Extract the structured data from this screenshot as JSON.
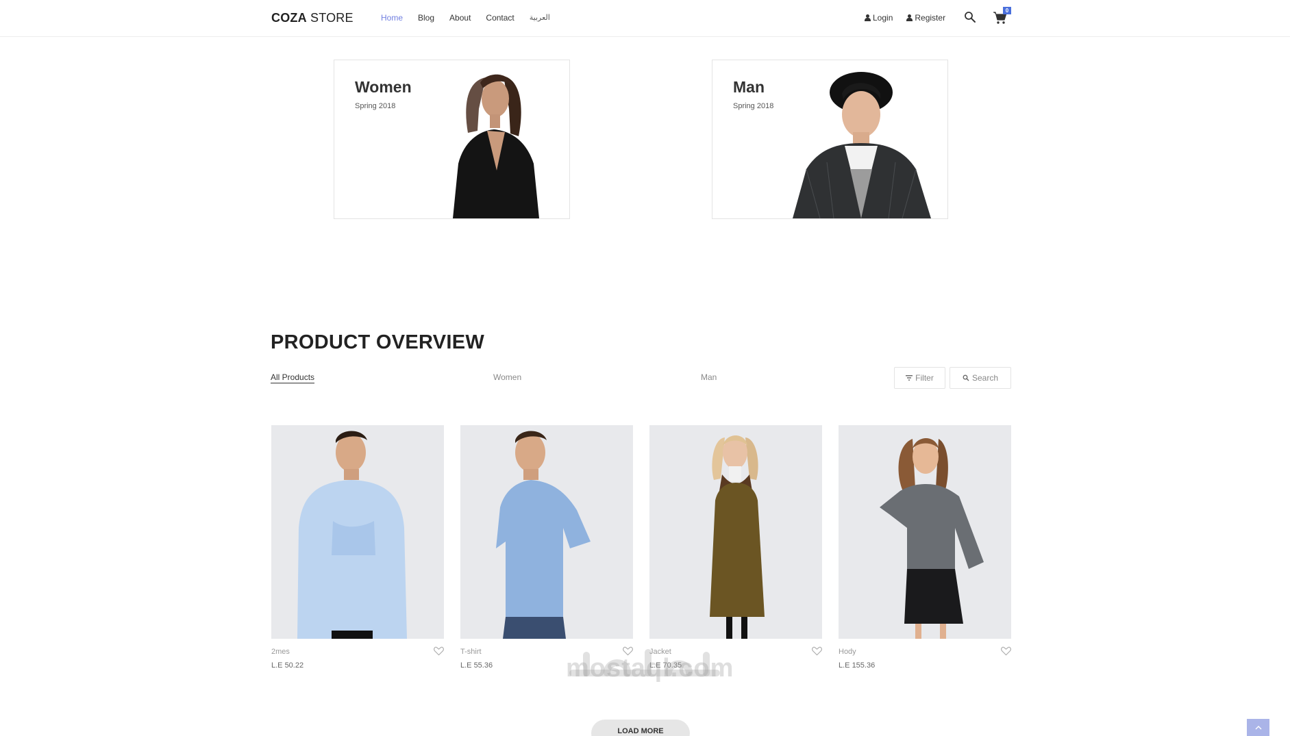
{
  "header": {
    "logo_bold": "COZA",
    "logo_light": "STORE",
    "nav": [
      {
        "label": "Home",
        "active": true
      },
      {
        "label": "Blog",
        "active": false
      },
      {
        "label": "About",
        "active": false
      },
      {
        "label": "Contact",
        "active": false
      },
      {
        "label": "العربية",
        "active": false
      }
    ],
    "login_label": "Login",
    "register_label": "Register",
    "cart_count": "0"
  },
  "banners": [
    {
      "title": "Women",
      "subtitle": "Spring 2018"
    },
    {
      "title": "Man",
      "subtitle": "Spring 2018"
    }
  ],
  "overview": {
    "title": "PRODUCT OVERVIEW",
    "tabs": [
      "All Products",
      "Women",
      "Man"
    ],
    "filter_label": "Filter",
    "search_label": "Search"
  },
  "products": [
    {
      "name": "2mes",
      "price": "L.E 50.22"
    },
    {
      "name": "T-shirt",
      "price": "L.E 55.36"
    },
    {
      "name": "Jacket",
      "price": "L.E 70.35"
    },
    {
      "name": "Hody",
      "price": "L.E 155.36"
    }
  ],
  "load_more_label": "LOAD MORE",
  "watermark": "mostaql.com",
  "colors": {
    "accent": "#717fe0",
    "badge": "#4a6fdc",
    "back_to_top": "#aab4e8"
  }
}
